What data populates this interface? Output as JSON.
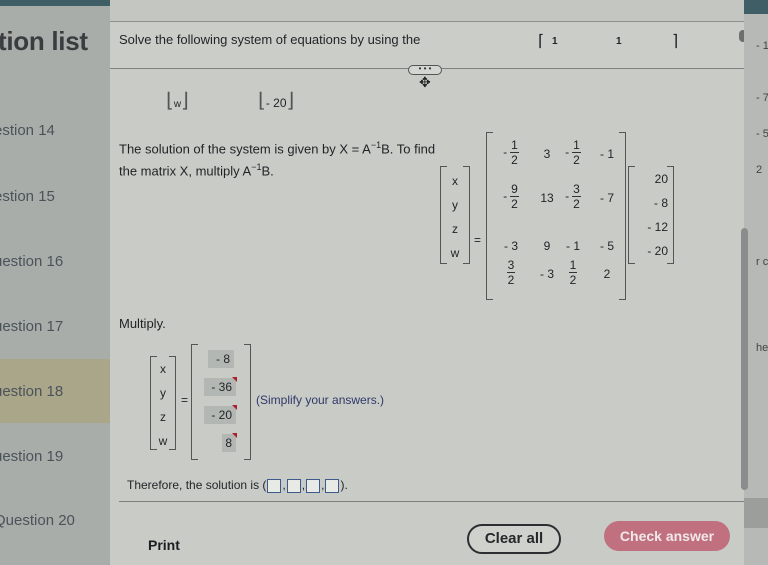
{
  "sidebar": {
    "title": "tion list",
    "items": [
      {
        "label": "estion 14",
        "active": false
      },
      {
        "label": "estion 15",
        "active": false
      },
      {
        "label": "uestion 16",
        "active": false
      },
      {
        "label": "uestion 17",
        "active": false
      },
      {
        "label": "uestion 18",
        "active": true
      },
      {
        "label": "uestion 19",
        "active": false
      },
      {
        "label": "Question 20",
        "active": false
      }
    ]
  },
  "question": {
    "prompt": "Solve the following system of equations by using the",
    "header_matrix_values": [
      "1",
      "1"
    ],
    "row_tail": {
      "var": "w",
      "const": "- 20"
    },
    "drag_handle_label": "• • •",
    "solution_intro_1": "The solution of the system is given by X = A",
    "solution_intro_sup": "−1",
    "solution_intro_2": "B. To find the matrix X, multiply A",
    "solution_intro_3": "B.",
    "variables": [
      "x",
      "y",
      "z",
      "w"
    ],
    "inverse_matrix": [
      [
        "-1/2",
        "3",
        "-1/2",
        "-1"
      ],
      [
        "-9/2",
        "13",
        "-3/2",
        "-7"
      ],
      [
        "-3",
        "9",
        "-1",
        "-5"
      ],
      [
        "3/2",
        "-3",
        "1/2",
        "2"
      ]
    ],
    "b_vector": [
      "20",
      "- 8",
      "- 12",
      "- 20"
    ],
    "multiply_label": "Multiply.",
    "answers": [
      {
        "value": "- 8",
        "flagged": false
      },
      {
        "value": "- 36",
        "flagged": true
      },
      {
        "value": "- 20",
        "flagged": true
      },
      {
        "value": "8",
        "flagged": true
      }
    ],
    "simplify_note": "(Simplify your answers.)",
    "therefore_text": "Therefore, the solution is",
    "solution_blanks": [
      "",
      "",
      "",
      ""
    ]
  },
  "footer": {
    "print_label": "Print",
    "clear_label": "Clear all",
    "check_label": "Check answer"
  },
  "right_edge_fragments": [
    "- 1",
    "- 7",
    "- 5",
    "2",
    "r c",
    "he"
  ],
  "colors": {
    "active_item": "#a9a68a",
    "check_button": "#c0707e",
    "flag": "#b01e2e",
    "header_teal": "#3f5e66"
  }
}
